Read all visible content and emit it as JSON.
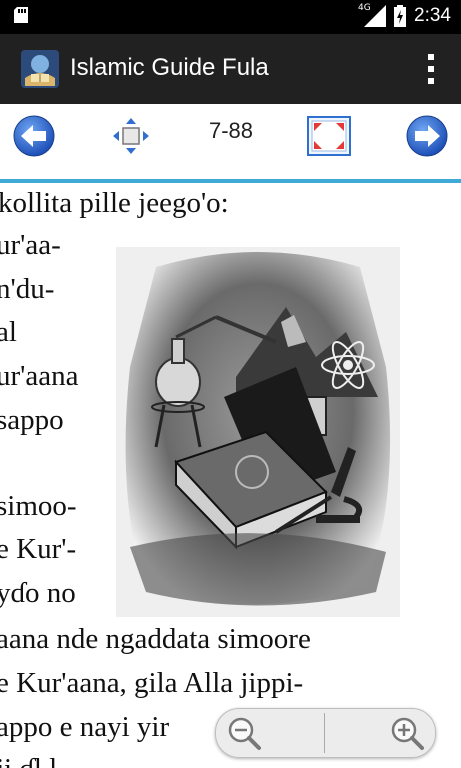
{
  "status_bar": {
    "time": "2:34",
    "network": "4G",
    "icons": [
      "sd-card-icon",
      "signal-icon",
      "battery-charging-icon"
    ]
  },
  "app_bar": {
    "title": "Islamic Guide Fula",
    "icons": [
      "app-logo-icon",
      "overflow-menu-icon"
    ]
  },
  "toolbar": {
    "page_indicator": "7-88",
    "icons": [
      "previous-page-arrow-icon",
      "move-arrows-icon",
      "fit-screen-icon",
      "next-page-arrow-icon"
    ]
  },
  "page_text": {
    "lines": [
      "kollita pille jeego'o:",
      "ur'aa-",
      "n'du-",
      "al",
      "ur'aana",
      "sappo",
      "simoo-",
      "e Kur'-",
      "yɗo no",
      "aana nde ngaddata simoore",
      "e Kur'aana, gila Alla  jippi-",
      "appo e nayi yir",
      "ji   ɗl              l"
    ],
    "illustration": "book-science-illustration"
  },
  "zoom_control": {
    "icons": [
      "zoom-out-icon",
      "zoom-in-icon"
    ]
  },
  "colors": {
    "status_bar": "#000000",
    "app_bar": "#212121",
    "accent_divider": "#3fa9d8",
    "nav_arrow": "#2f6fd0"
  }
}
